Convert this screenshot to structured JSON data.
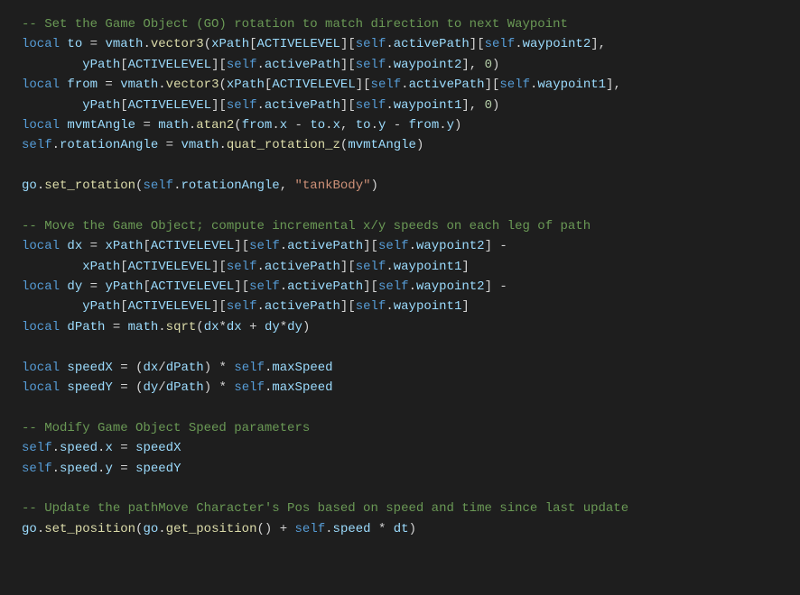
{
  "code": {
    "c1": "-- Set the Game Object (GO) rotation to match direction to next Waypoint",
    "kw_local": "local",
    "to": "to",
    "eq": " = ",
    "vmath": "vmath",
    "dot": ".",
    "vector3": "vector3",
    "lparen": "(",
    "rparen": ")",
    "xPath": "xPath",
    "lbrack": "[",
    "rbrack": "]",
    "ACTIVELEVEL": "ACTIVELEVEL",
    "self": "self",
    "activePath": "activePath",
    "waypoint2": "waypoint2",
    "waypoint1": "waypoint1",
    "comma": ",",
    "sp": " ",
    "indent": "        ",
    "yPath": "yPath",
    "zero": "0",
    "from": "from",
    "mvmtAngle": "mvmtAngle",
    "math": "math",
    "atan2": "atan2",
    "x": "x",
    "y": "y",
    "minus": " - ",
    "rotationAngle": "rotationAngle",
    "quat_rotation_z": "quat_rotation_z",
    "go": "go",
    "set_rotation": "set_rotation",
    "tankBody": "\"tankBody\"",
    "c2": "-- Move the Game Object; compute incremental x/y speeds on each leg of path",
    "dx": "dx",
    "dy": "dy",
    "dPath": "dPath",
    "sqrt": "sqrt",
    "star": "*",
    "plus": " + ",
    "speedX": "speedX",
    "speedY": "speedY",
    "slash": "/",
    "maxSpeed": "maxSpeed",
    "c3": "-- Modify Game Object Speed parameters",
    "speed": "speed",
    "c4": "-- Update the pathMove Character's Pos based on speed and time since last update",
    "set_position": "set_position",
    "get_position": "get_position",
    "dt": "dt"
  }
}
